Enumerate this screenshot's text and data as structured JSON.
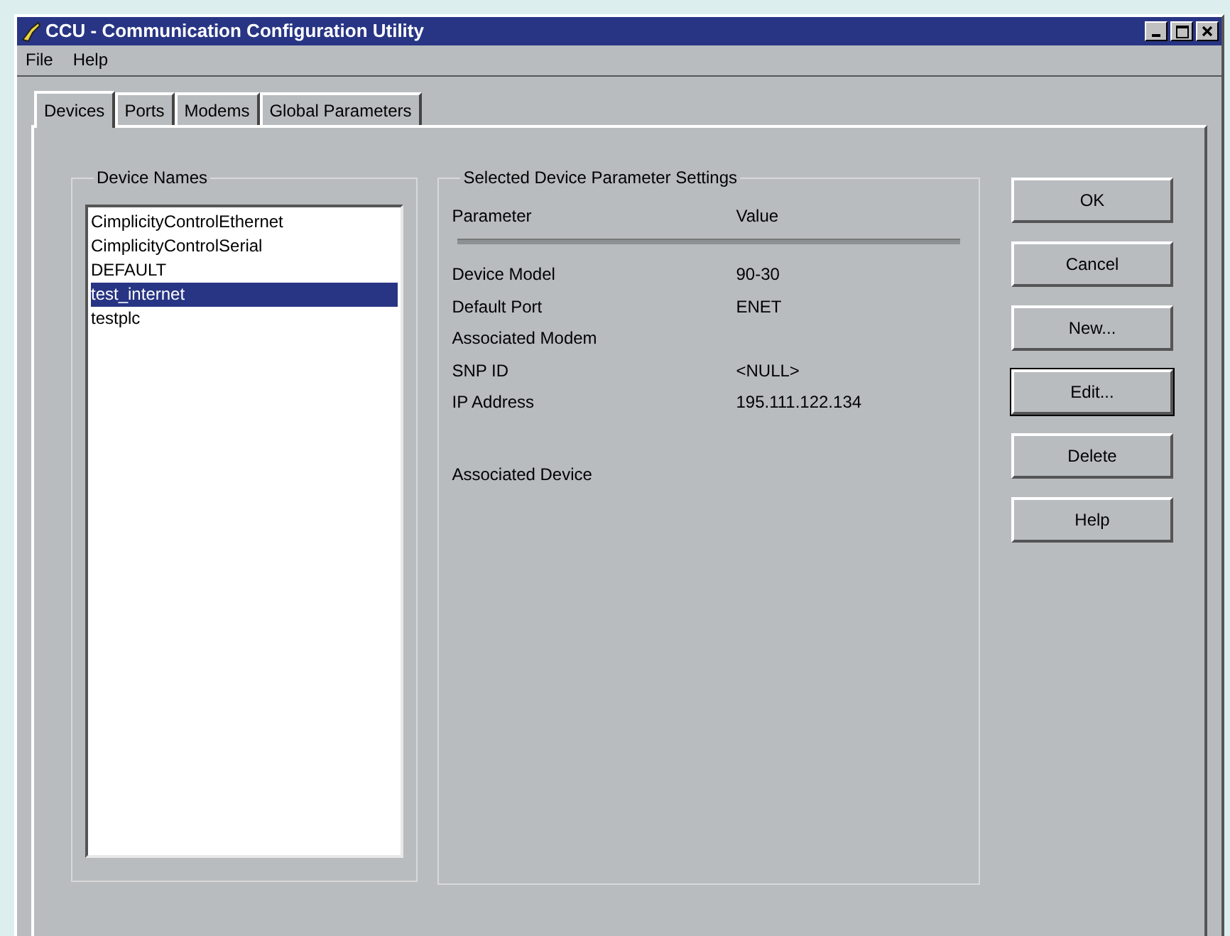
{
  "window": {
    "title": "CCU - Communication Configuration Utility"
  },
  "menu": [
    "File",
    "Help"
  ],
  "tabs": [
    {
      "label": "Devices",
      "selected": true
    },
    {
      "label": "Ports",
      "selected": false
    },
    {
      "label": "Modems",
      "selected": false
    },
    {
      "label": "Global Parameters",
      "selected": false
    }
  ],
  "device_names": {
    "title": "Device Names",
    "items": [
      {
        "label": "CimplicityControlEthernet",
        "selected": false
      },
      {
        "label": "CimplicityControlSerial",
        "selected": false
      },
      {
        "label": "DEFAULT",
        "selected": false
      },
      {
        "label": "test_internet",
        "selected": true
      },
      {
        "label": "testplc",
        "selected": false
      }
    ]
  },
  "settings": {
    "title": "Selected Device Parameter Settings",
    "columns": [
      "Parameter",
      "Value"
    ],
    "rows": [
      {
        "parameter": "Device Model",
        "value": "90-30"
      },
      {
        "parameter": "Default Port",
        "value": "ENET"
      },
      {
        "parameter": "Associated Modem"
      },
      {
        "parameter": "SNP ID",
        "value": "<NULL>"
      },
      {
        "parameter": "IP Address",
        "value": "195.111.122.134"
      }
    ],
    "associated_device": "Associated Device"
  },
  "buttons": [
    {
      "label": "OK",
      "default": false
    },
    {
      "label": "Cancel",
      "default": false
    },
    {
      "label": "New...",
      "default": false
    },
    {
      "label": "Edit...",
      "default": true
    },
    {
      "label": "Delete",
      "default": false
    },
    {
      "label": "Help",
      "default": false
    }
  ]
}
